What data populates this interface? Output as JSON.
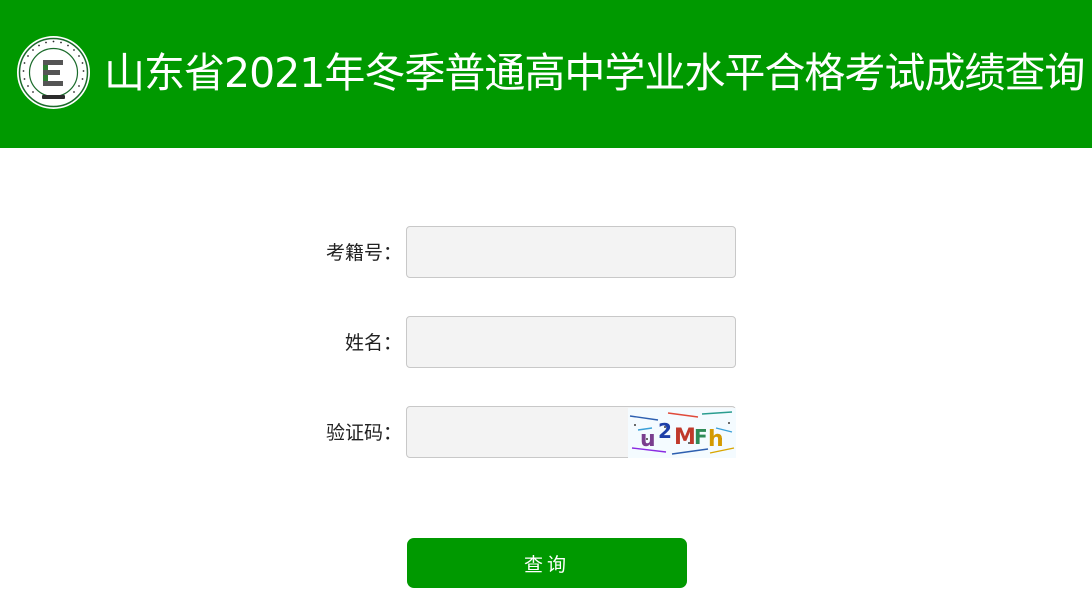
{
  "header": {
    "title": "山东省2021年冬季普通高中学业水平合格考试成绩查询",
    "background_color": "#009900",
    "logo_icon": "exam-institute-logo-icon",
    "logo_letter": "E"
  },
  "form": {
    "exam_id_label": "考籍号：",
    "exam_id_value": "",
    "name_label": "姓名：",
    "name_value": "",
    "captcha_label": "验证码：",
    "captcha_value": "",
    "captcha_image_text": "u2MFh",
    "submit_label": "查询"
  }
}
